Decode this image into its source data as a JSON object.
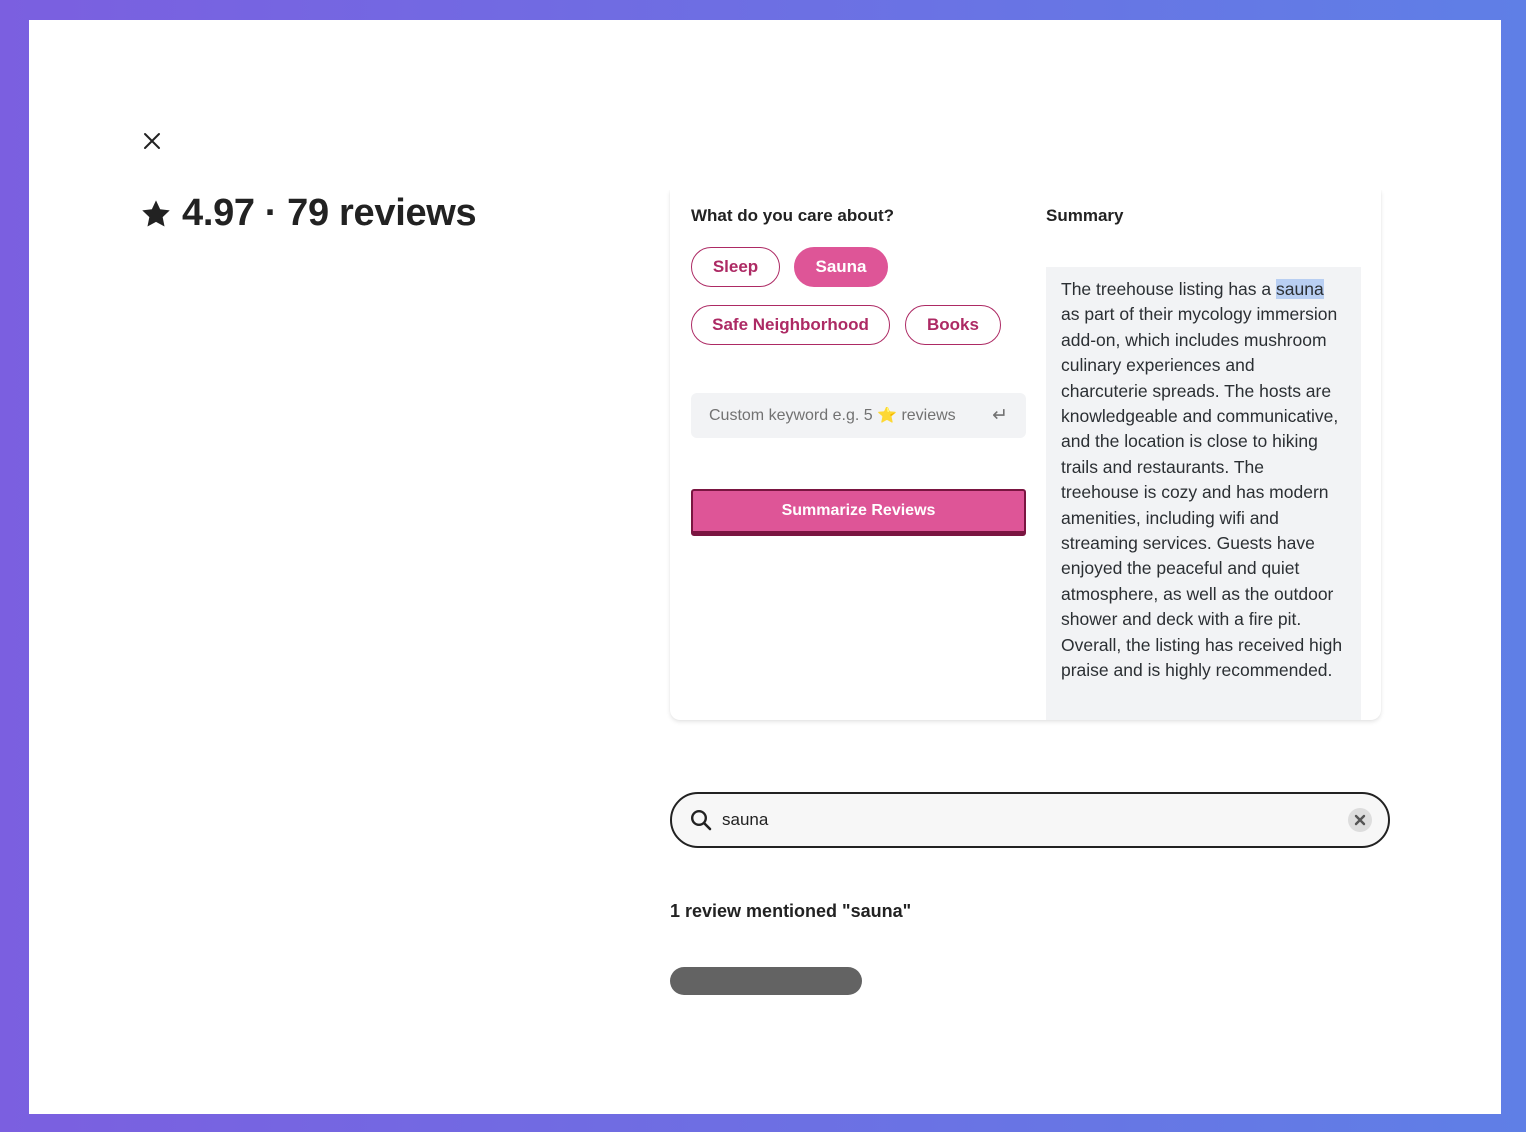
{
  "header": {
    "rating": "4.97",
    "separator": "·",
    "reviews_count": "79 reviews"
  },
  "icons": {
    "close": "close-icon",
    "star": "star-icon",
    "search": "search-icon",
    "clear": "clear-icon",
    "enter": "enter-icon"
  },
  "care": {
    "title": "What do you care about?",
    "chips": [
      {
        "label": "Sleep",
        "active": false
      },
      {
        "label": "Sauna",
        "active": true
      },
      {
        "label": "Safe Neighborhood",
        "active": false
      },
      {
        "label": "Books",
        "active": false
      }
    ],
    "keyword_placeholder": "Custom keyword e.g. 5 ⭐️ reviews",
    "summarize_label": "Summarize Reviews"
  },
  "summary": {
    "title": "Summary",
    "text_before": "The treehouse listing has a ",
    "highlight": "sauna",
    "text_after": " as part of their mycology immersion add-on, which includes mushroom culinary experiences and charcuterie spreads. The hosts are knowledgeable and communicative, and the location is close to hiking trails and restaurants. The treehouse is cozy and has modern amenities, including wifi and streaming services. Guests have enjoyed the peaceful and quiet atmosphere, as well as the outdoor shower and deck with a fire pit. Overall, the listing has received high praise and is highly recommended."
  },
  "search": {
    "value": "sauna"
  },
  "results": {
    "mentions_text": "1 review mentioned \"sauna\""
  },
  "colors": {
    "accent": "#de5597",
    "accent_dark": "#ad2a64",
    "text": "#222222"
  }
}
